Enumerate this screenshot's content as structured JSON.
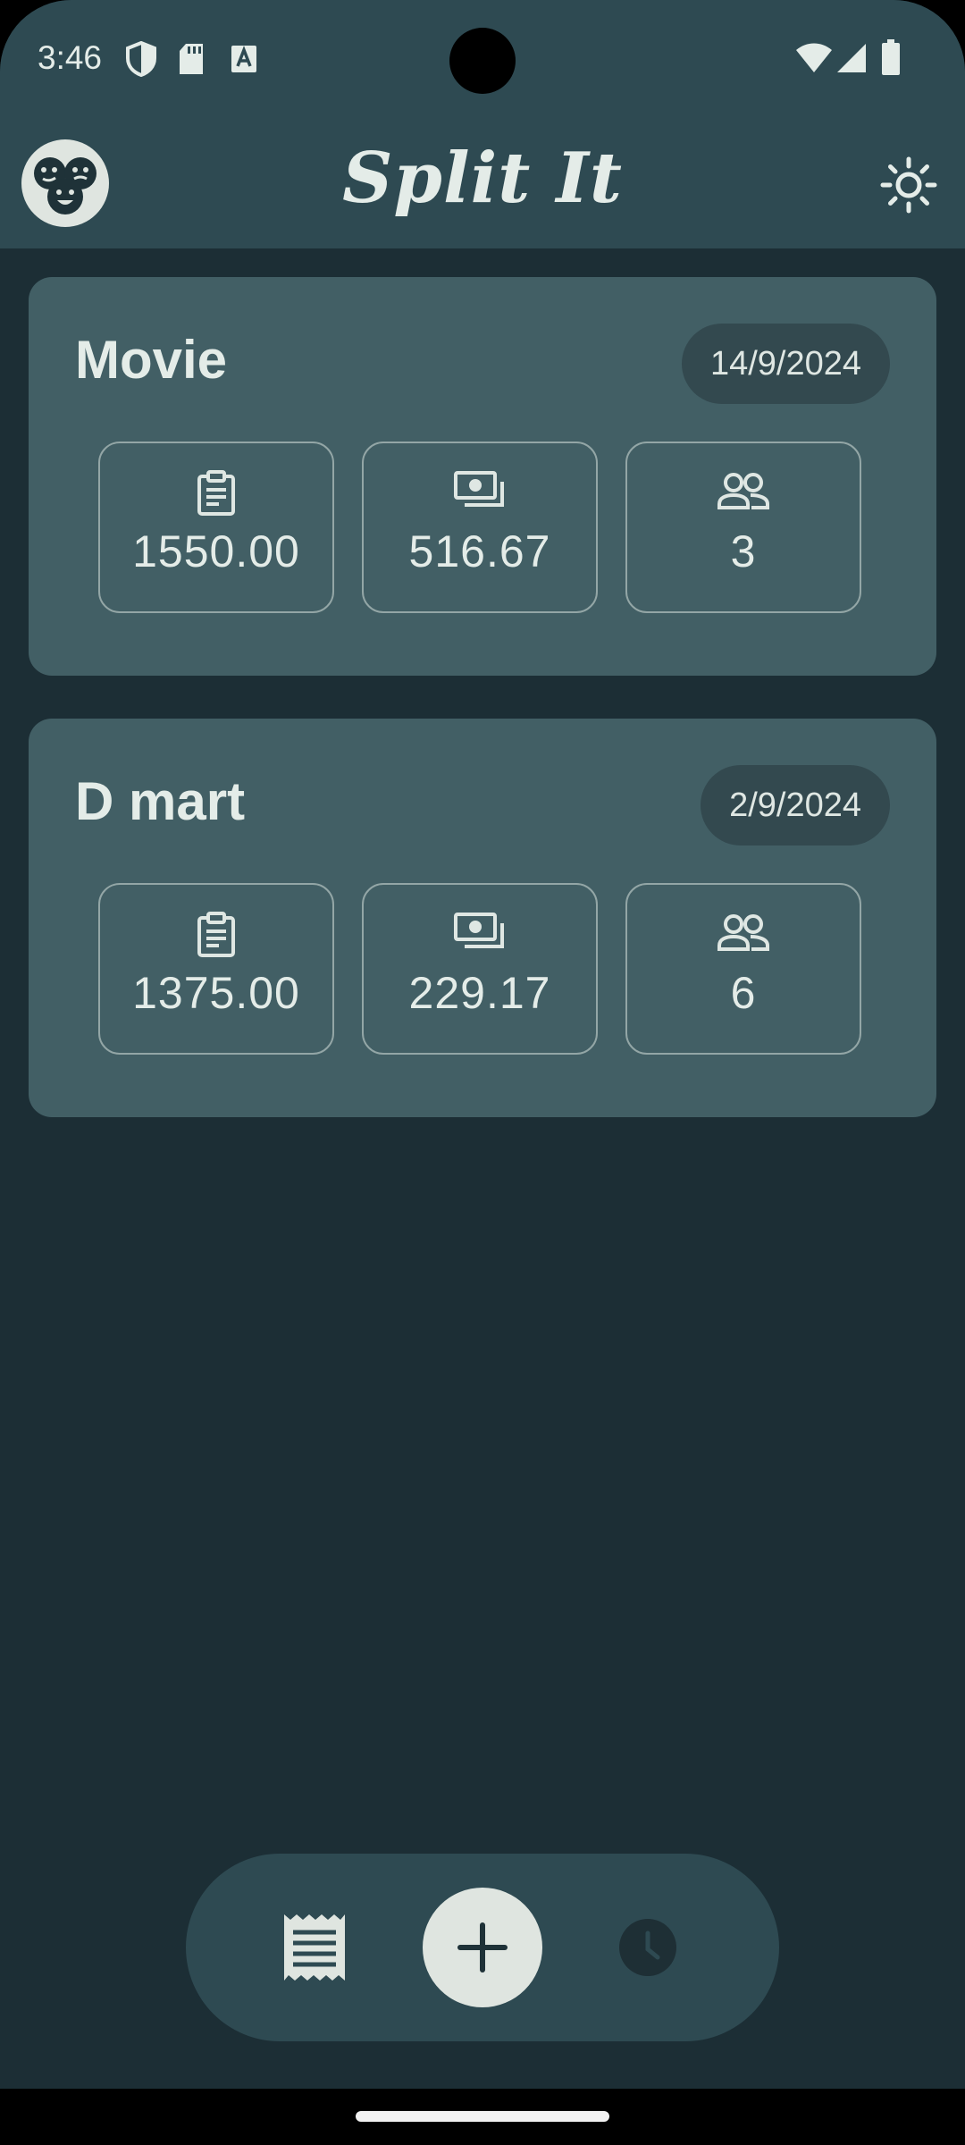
{
  "status_bar": {
    "time": "3:46",
    "left_icons": [
      "shield-icon",
      "sd-card-icon",
      "font-a-icon"
    ],
    "right_icons": [
      "wifi-icon",
      "signal-icon",
      "battery-icon"
    ]
  },
  "app_bar": {
    "title": "Split It",
    "logo_icon": "faces-logo-icon",
    "theme_icon": "sun-icon"
  },
  "splits": [
    {
      "title": "Movie",
      "date": "14/9/2024",
      "total": "1550.00",
      "per_person": "516.67",
      "people": "3"
    },
    {
      "title": "D mart",
      "date": "2/9/2024",
      "total": "1375.00",
      "per_person": "229.17",
      "people": "6"
    }
  ],
  "bottom_nav": {
    "items": [
      "receipt-icon",
      "add-icon",
      "history-icon"
    ]
  },
  "colors": {
    "background": "#1c2e35",
    "app_bar": "#2e4a52",
    "card": "#425f65",
    "pill": "#33494f",
    "foreground": "#e4ece8"
  }
}
